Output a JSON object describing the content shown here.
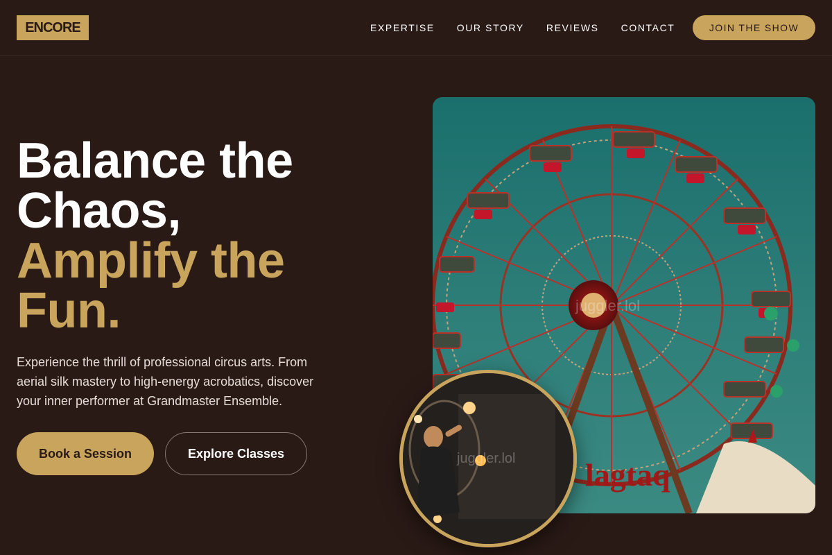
{
  "brand": {
    "logo_text": "ENCORE"
  },
  "nav": {
    "items": [
      "EXPERTISE",
      "OUR STORY",
      "REVIEWS",
      "CONTACT"
    ],
    "cta_label": "JOIN THE SHOW"
  },
  "hero": {
    "headline_line1": "Balance the",
    "headline_line2": "Chaos,",
    "headline_line3": "Amplify the",
    "headline_line4": "Fun.",
    "description": "Experience the thrill of professional circus arts. From aerial silk mastery to high-energy acrobatics, discover your inner performer at Grandmaster Ensemble.",
    "primary_button": "Book a Session",
    "secondary_button": "Explore Classes"
  },
  "images": {
    "main_watermark": "juggler.lol",
    "circle_watermark": "juggler.lol",
    "main_alt": "ferris-wheel-photo",
    "circle_alt": "fire-hoop-performer-photo"
  },
  "colors": {
    "background": "#2a1a16",
    "accent": "#c9a45c",
    "text": "#ffffff"
  }
}
